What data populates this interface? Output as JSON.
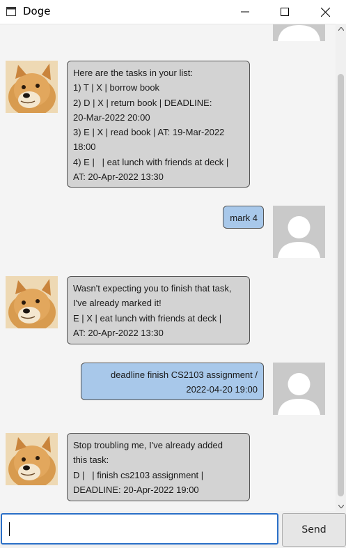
{
  "window": {
    "title": "Doge"
  },
  "chat": {
    "messages": [
      {
        "sender": "doge",
        "text": "Here are the tasks in your list:\n1) T | X | borrow book\n2) D | X | return book | DEADLINE:\n20-Mar-2022 20:00\n3) E | X | read book | AT: 19-Mar-2022\n18:00\n4) E |   | eat lunch with friends at deck |\nAT: 20-Apr-2022 13:30"
      },
      {
        "sender": "user",
        "text": "mark 4"
      },
      {
        "sender": "doge",
        "text": "Wasn't expecting you to finish that task,\nI've already marked it!\nE | X | eat lunch with friends at deck |\nAT: 20-Apr-2022 13:30"
      },
      {
        "sender": "user",
        "text": "deadline finish CS2103 assignment /\n2022-04-20 19:00"
      },
      {
        "sender": "doge",
        "text": "Stop troubling me, I've already added\nthis task:\nD |   | finish cs2103 assignment |\nDEADLINE: 20-Apr-2022 19:00"
      }
    ]
  },
  "input": {
    "value": ""
  },
  "send_button": {
    "label": "Send"
  }
}
